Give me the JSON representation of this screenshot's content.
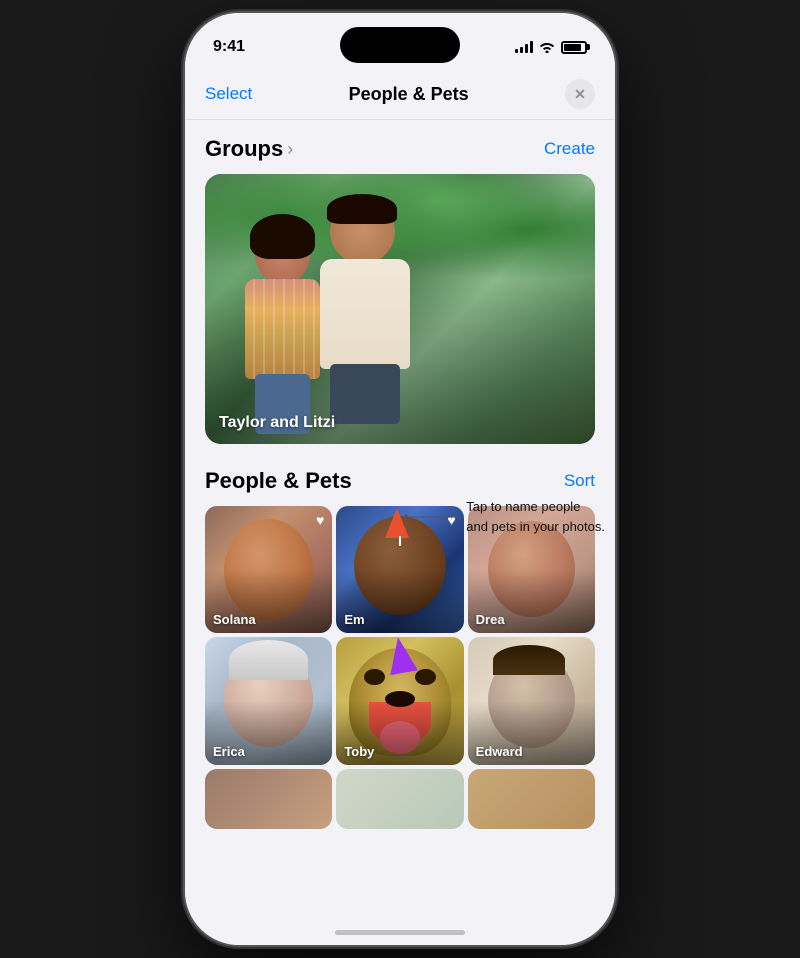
{
  "status_bar": {
    "time": "9:41",
    "signal_label": "signal",
    "wifi_label": "wifi",
    "battery_label": "battery"
  },
  "nav": {
    "select_label": "Select",
    "title": "People & Pets",
    "close_icon": "✕"
  },
  "groups": {
    "title": "Groups",
    "chevron": "›",
    "create_label": "Create",
    "card": {
      "label": "Taylor and Litzi"
    }
  },
  "people_pets": {
    "title": "People & Pets",
    "sort_label": "Sort",
    "tooltip": "Tap to name people\nand pets in your photos.",
    "people": [
      {
        "name": "Solana",
        "favorite": true,
        "tile_class": "tile-solana",
        "face_class": "face-solana"
      },
      {
        "name": "Em",
        "favorite": true,
        "tile_class": "tile-em",
        "face_class": "face-em"
      },
      {
        "name": "Drea",
        "favorite": false,
        "tile_class": "tile-drea",
        "face_class": "face-drea"
      },
      {
        "name": "Erica",
        "favorite": false,
        "tile_class": "tile-erica",
        "face_class": "face-erica"
      },
      {
        "name": "Toby",
        "favorite": false,
        "tile_class": "tile-toby",
        "face_class": "face-toby"
      },
      {
        "name": "Edward",
        "favorite": false,
        "tile_class": "tile-edward",
        "face_class": "face-edward"
      }
    ],
    "partial_people": [
      {
        "name": "",
        "tile_class": "tile-solana"
      },
      {
        "name": "",
        "tile_class": "tile-erica"
      },
      {
        "name": "",
        "tile_class": "tile-drea"
      }
    ]
  }
}
